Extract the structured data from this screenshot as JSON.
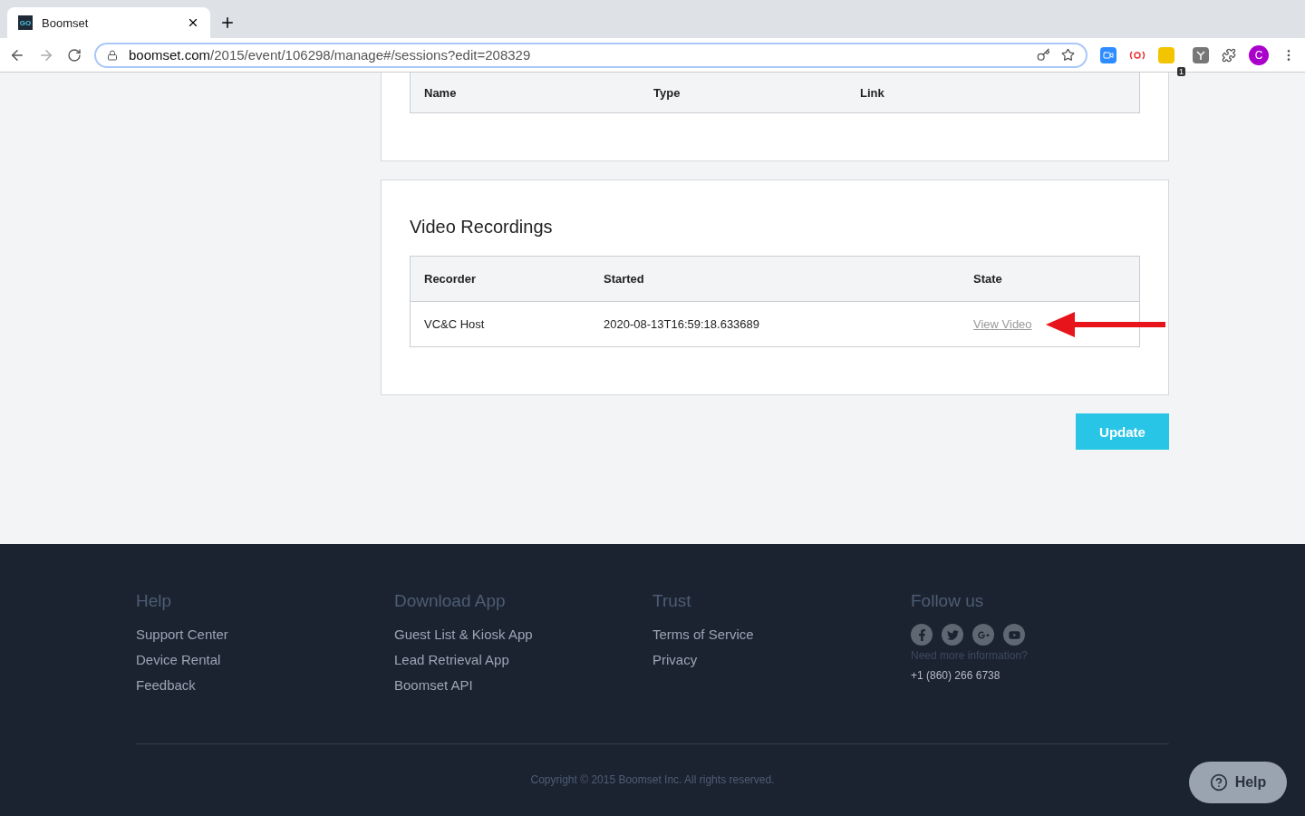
{
  "browser": {
    "tab": {
      "title": "Boomset",
      "favicon": "GO"
    },
    "url": {
      "host": "boomset.com",
      "path": "/2015/event/106298/manage#/sessions?edit=208329"
    },
    "profile_initial": "C",
    "extension_badge": "1"
  },
  "links_table": {
    "columns": [
      "Name",
      "Type",
      "Link"
    ]
  },
  "recordings": {
    "title": "Video Recordings",
    "columns": [
      "Recorder",
      "Started",
      "State"
    ],
    "rows": [
      {
        "recorder": "VC&C Host",
        "started": "2020-08-13T16:59:18.633689",
        "state": "View Video",
        "annotated": true
      }
    ]
  },
  "update_button": "Update",
  "footer": {
    "columns": [
      {
        "heading": "Help",
        "links": [
          "Support Center",
          "Device Rental",
          "Feedback"
        ]
      },
      {
        "heading": "Download App",
        "links": [
          "Guest List & Kiosk App",
          "Lead Retrieval App",
          "Boomset API"
        ]
      },
      {
        "heading": "Trust",
        "links": [
          "Terms of Service",
          "Privacy"
        ]
      },
      {
        "heading": "Follow us",
        "note": "Need more information?",
        "phone": "+1 (860) 266 6738"
      }
    ],
    "copyright": "Copyright © 2015 Boomset Inc. All rights reserved.",
    "help_button": "Help"
  }
}
